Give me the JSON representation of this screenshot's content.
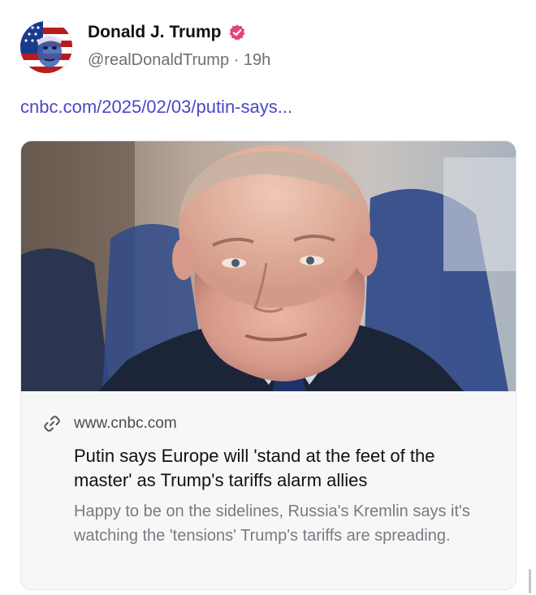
{
  "author": {
    "name": "Donald J. Trump",
    "handle": "@realDonaldTrump",
    "separator": "·",
    "time": "19h",
    "verified_color": "#e0457b"
  },
  "post": {
    "link_text": "cnbc.com/2025/02/03/putin-says...",
    "link_color": "#4b46c8"
  },
  "card": {
    "domain": "www.cnbc.com",
    "title": "Putin says Europe will 'stand at the feet of the master' as Trump's tariffs alarm allies",
    "description": "Happy to be on the sidelines, Russia's Kremlin says it's watching the 'tensions' Trump's tariffs are spreading."
  },
  "icons": {
    "verified": "verified-badge-icon",
    "link": "link-icon"
  }
}
